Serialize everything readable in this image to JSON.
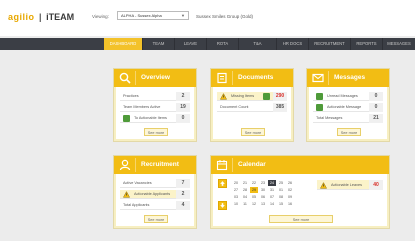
{
  "topbar": {
    "logo_brand": "agilio",
    "logo_sep": "|",
    "logo_team": "iTEAM",
    "viewing_label": "Viewing:",
    "site_select_value": "ALPHA - Sussex Alpha",
    "group_name": "Sussex Smiles Group (Gold)"
  },
  "nav": {
    "items": [
      "DASHBOARD",
      "TEAM",
      "LEAVE",
      "ROTA",
      "T&A",
      "HR DOCS",
      "RECRUITMENT",
      "REPORTS",
      "MESSAGES"
    ]
  },
  "overview": {
    "title": "Overview",
    "rows": [
      {
        "label": "Practices",
        "value": "2"
      },
      {
        "label": "Team Members Active",
        "value": "19"
      },
      {
        "label": "To Actionable Items",
        "value": "0"
      }
    ],
    "see_more": "See more"
  },
  "documents": {
    "title": "Documents",
    "rows": [
      {
        "label": "Missing Items",
        "value": "290"
      },
      {
        "label": "Document Count",
        "value": "385"
      }
    ],
    "see_more": "See more"
  },
  "messages": {
    "title": "Messages",
    "rows": [
      {
        "label": "Unread Messages",
        "value": "0"
      },
      {
        "label": "Actionable Message",
        "value": "0"
      },
      {
        "label": "Total Messages",
        "value": "21"
      }
    ],
    "see_more": "See more"
  },
  "recruitment": {
    "title": "Recruitment",
    "rows": [
      {
        "label": "Active Vacancies",
        "value": "7"
      },
      {
        "label": "Actionable Applicants",
        "value": "2"
      },
      {
        "label": "Total Applicants",
        "value": "4"
      }
    ],
    "see_more": "See more"
  },
  "calendar": {
    "title": "Calendar",
    "days": [
      [
        "20",
        "21",
        "22",
        "23",
        "24",
        "25",
        "26"
      ],
      [
        "27",
        "28",
        "29",
        "30",
        "31",
        "01",
        "02"
      ],
      [
        "03",
        "04",
        "05",
        "06",
        "07",
        "08",
        "09"
      ],
      [
        "10",
        "11",
        "12",
        "13",
        "14",
        "15",
        "16"
      ]
    ],
    "actionable_label": "Actionable Leaves",
    "actionable_value": "40",
    "see_more": "See more"
  }
}
